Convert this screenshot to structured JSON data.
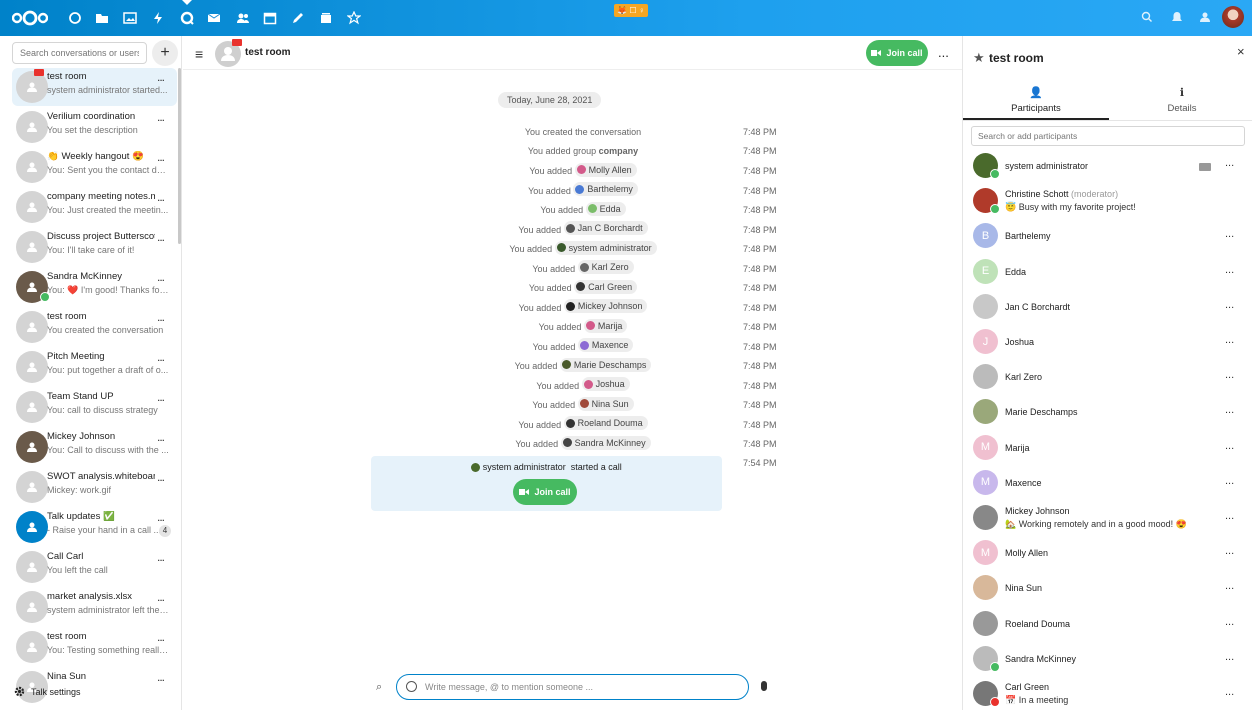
{
  "topbar": {
    "apps": [
      "dashboard-icon",
      "files-icon",
      "photos-icon",
      "activity-icon",
      "talk-icon",
      "mail-icon",
      "contacts-icon",
      "calendar-icon",
      "notes-icon",
      "deck-icon",
      "favorites-icon"
    ],
    "status_emoji": "🦊 ☐ ♀",
    "accent": "#0082c9"
  },
  "sidebar": {
    "search_placeholder": "Search conversations or users",
    "plus": "+",
    "conversations": [
      {
        "name": "test room",
        "last": "system administrator started...",
        "active": true
      },
      {
        "name": "Verilium coordination",
        "last": "You set the description"
      },
      {
        "name": "👏 Weekly hangout 😍",
        "last": "You: Sent you the contact det..."
      },
      {
        "name": "company meeting notes.md",
        "last": "You: Just created the meetin..."
      },
      {
        "name": "Discuss project Butterscot...",
        "last": "You: I'll take care of it!"
      },
      {
        "name": "Sandra McKinney",
        "last": "You: ❤️ I'm good! Thanks for ..."
      },
      {
        "name": "test room",
        "last": "You created the conversation"
      },
      {
        "name": "Pitch Meeting",
        "last": "You: put together a draft of o..."
      },
      {
        "name": "Team Stand UP",
        "last": "You: call to discuss strategy"
      },
      {
        "name": "Mickey Johnson",
        "last": "You: Call to discuss with the ..."
      },
      {
        "name": "SWOT analysis.whiteboard",
        "last": "Mickey: work.gif"
      },
      {
        "name": "Talk updates ✅",
        "last": "- Raise your hand in a call ...",
        "badge": "4"
      },
      {
        "name": "Call Carl",
        "last": "You left the call"
      },
      {
        "name": "market analysis.xlsx",
        "last": "system administrator left the ..."
      },
      {
        "name": "test room",
        "last": "You: Testing something really..."
      },
      {
        "name": "Nina Sun",
        "last": ""
      }
    ],
    "more": "...",
    "settings_label": "Talk settings"
  },
  "main": {
    "title": "test room",
    "join_label": "Join call",
    "more": "...",
    "date": "Today, June 28, 2021",
    "prefix": "You added",
    "created": "You created the conversation",
    "group_prefix": "You added group",
    "group_name": "company",
    "rows": [
      {
        "name": "Molly Allen",
        "time": "7:48 PM",
        "color": "#d35a8a"
      },
      {
        "name": "Barthelemy",
        "time": "7:48 PM",
        "color": "#4a7ad4"
      },
      {
        "name": "Edda",
        "time": "7:48 PM",
        "color": "#7bbd6a"
      },
      {
        "name": "Jan C Borchardt",
        "time": "7:48 PM",
        "color": "#555"
      },
      {
        "name": "system administrator",
        "time": "7:48 PM",
        "color": "#3a5a2c"
      },
      {
        "name": "Karl Zero",
        "time": "7:48 PM",
        "color": "#666"
      },
      {
        "name": "Carl Green",
        "time": "7:48 PM",
        "color": "#333"
      },
      {
        "name": "Mickey Johnson",
        "time": "7:48 PM",
        "color": "#222"
      },
      {
        "name": "Marija",
        "time": "7:48 PM",
        "color": "#d35a8a"
      },
      {
        "name": "Maxence",
        "time": "7:48 PM",
        "color": "#8c6ad4"
      },
      {
        "name": "Marie Deschamps",
        "time": "7:48 PM",
        "color": "#4a5a2a"
      },
      {
        "name": "Joshua",
        "time": "7:48 PM",
        "color": "#d35a8a"
      },
      {
        "name": "Nina Sun",
        "time": "7:48 PM",
        "color": "#a04a3a"
      },
      {
        "name": "Roeland Douma",
        "time": "7:48 PM",
        "color": "#333"
      },
      {
        "name": "Sandra McKinney",
        "time": "7:48 PM",
        "color": "#444"
      }
    ],
    "created_time": "7:48 PM",
    "group_time": "7:48 PM",
    "call_time": "7:54 PM",
    "call_actor": "system administrator",
    "call_text": "started a call",
    "composer_placeholder": "Write message, @ to mention someone ..."
  },
  "right": {
    "title": "test room",
    "close": "×",
    "tabs": [
      "Participants",
      "Details"
    ],
    "tab_icons": [
      "👤",
      "ℹ"
    ],
    "search_placeholder": "Search or add participants",
    "participants": [
      {
        "name": "system administrator",
        "status": "",
        "color": "#4a6a2c",
        "initial": ""
      },
      {
        "name": "Christine Schott",
        "tag": "(moderator)",
        "status": "😇 Busy with my favorite project!",
        "color": "#b03a2a",
        "initial": ""
      },
      {
        "name": "Barthelemy",
        "status": "",
        "color": "#a8b8e8",
        "initial": "B"
      },
      {
        "name": "Edda",
        "status": "",
        "color": "#bfe2b8",
        "initial": "E"
      },
      {
        "name": "Jan C Borchardt",
        "status": "",
        "color": "#c8c8c8",
        "initial": ""
      },
      {
        "name": "Joshua",
        "status": "",
        "color": "#f0c0d0",
        "initial": "J"
      },
      {
        "name": "Karl Zero",
        "status": "",
        "color": "#bbb",
        "initial": ""
      },
      {
        "name": "Marie Deschamps",
        "status": "",
        "color": "#9aa87a",
        "initial": ""
      },
      {
        "name": "Marija",
        "status": "",
        "color": "#f0c0d0",
        "initial": "M"
      },
      {
        "name": "Maxence",
        "status": "",
        "color": "#c8b8ec",
        "initial": "M"
      },
      {
        "name": "Mickey Johnson",
        "status": "🏡 Working remotely and in a good mood! 😍",
        "color": "#888",
        "initial": ""
      },
      {
        "name": "Molly Allen",
        "status": "",
        "color": "#f0c0d0",
        "initial": "M"
      },
      {
        "name": "Nina Sun",
        "status": "",
        "color": "#d8b89a",
        "initial": ""
      },
      {
        "name": "Roeland Douma",
        "status": "",
        "color": "#999",
        "initial": ""
      },
      {
        "name": "Sandra McKinney",
        "status": "",
        "color": "#bbb",
        "initial": ""
      },
      {
        "name": "Carl Green",
        "status": "📅 In a meeting",
        "color": "#777",
        "initial": ""
      }
    ],
    "more": "..."
  }
}
